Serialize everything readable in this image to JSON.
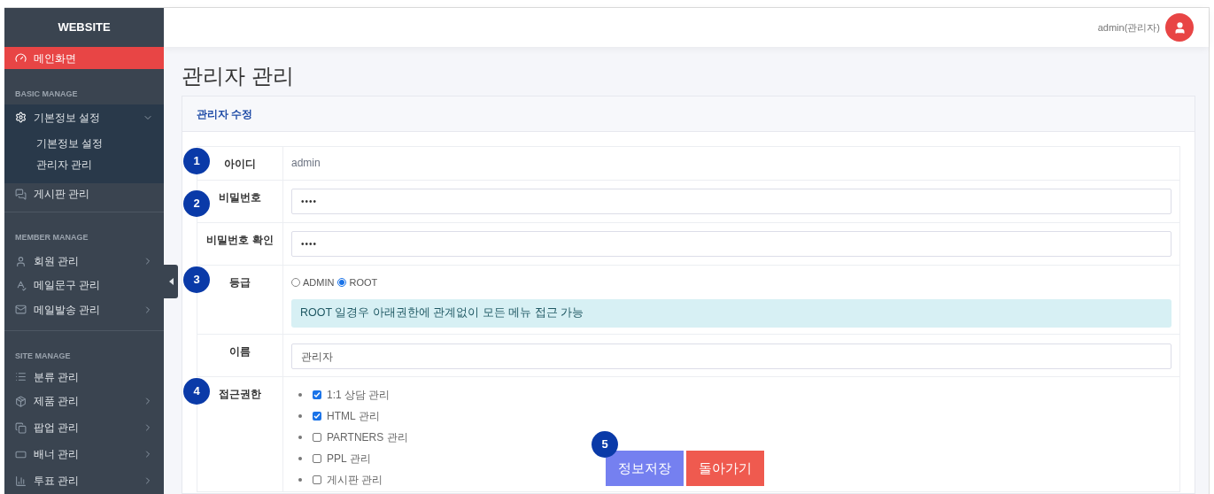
{
  "sidebar": {
    "brand": "WEBSITE",
    "items": [
      {
        "kind": "link",
        "label": "메인화면",
        "selected": true
      },
      {
        "kind": "section",
        "label": "BASIC MANAGE"
      },
      {
        "kind": "group",
        "label": "기본정보 설정",
        "expanded": true,
        "children": [
          {
            "label": "기본정보 설정"
          },
          {
            "label": "관리자 관리"
          }
        ]
      },
      {
        "kind": "link",
        "label": "게시판 관리",
        "selected": false
      },
      {
        "kind": "section",
        "label": "MEMBER MANAGE"
      },
      {
        "kind": "group",
        "label": "회원 관리",
        "expanded": false
      },
      {
        "kind": "link",
        "label": "메일문구 관리",
        "selected": false
      },
      {
        "kind": "group",
        "label": "메일발송 관리",
        "expanded": false
      },
      {
        "kind": "section",
        "label": "SITE MANAGE"
      },
      {
        "kind": "link",
        "label": "분류 관리",
        "selected": false
      },
      {
        "kind": "group",
        "label": "제품 관리",
        "expanded": false
      },
      {
        "kind": "group",
        "label": "팝업 관리",
        "expanded": false
      },
      {
        "kind": "group",
        "label": "배너 관리",
        "expanded": false
      },
      {
        "kind": "group",
        "label": "투표 관리",
        "expanded": false
      }
    ]
  },
  "header": {
    "user": "admin(관리자)"
  },
  "page_title": "관리자 관리",
  "card": {
    "title": "관리자 수정",
    "rows": [
      {
        "kind": "text",
        "label": "아이디",
        "value": "admin",
        "marker": "1"
      },
      {
        "kind": "password",
        "label": "비밀번호",
        "value": "••••",
        "marker": "2"
      },
      {
        "kind": "password",
        "label": "비밀번호 확인",
        "value": "••••"
      },
      {
        "kind": "radio",
        "label": "등급",
        "marker": "3",
        "options": [
          {
            "label": "ADMIN",
            "selected": false
          },
          {
            "label": "ROOT",
            "selected": true
          }
        ],
        "note": "ROOT 일경우 아래권한에 관계없이 모든 메뉴 접근 가능"
      },
      {
        "kind": "input",
        "label": "이름",
        "value": "관리자"
      },
      {
        "kind": "checklist",
        "label": "접근권한",
        "marker": "4",
        "options": [
          {
            "label": "1:1 상담 관리",
            "checked": true
          },
          {
            "label": "HTML 관리",
            "checked": true
          },
          {
            "label": "PARTNERS 관리",
            "checked": false
          },
          {
            "label": "PPL 관리",
            "checked": false
          },
          {
            "label": "게시판 관리",
            "checked": false
          }
        ]
      }
    ],
    "actions": {
      "marker": "5",
      "buttons": [
        {
          "kind": "primary",
          "label": "정보저장"
        },
        {
          "kind": "danger",
          "label": "돌아가기"
        }
      ]
    }
  }
}
